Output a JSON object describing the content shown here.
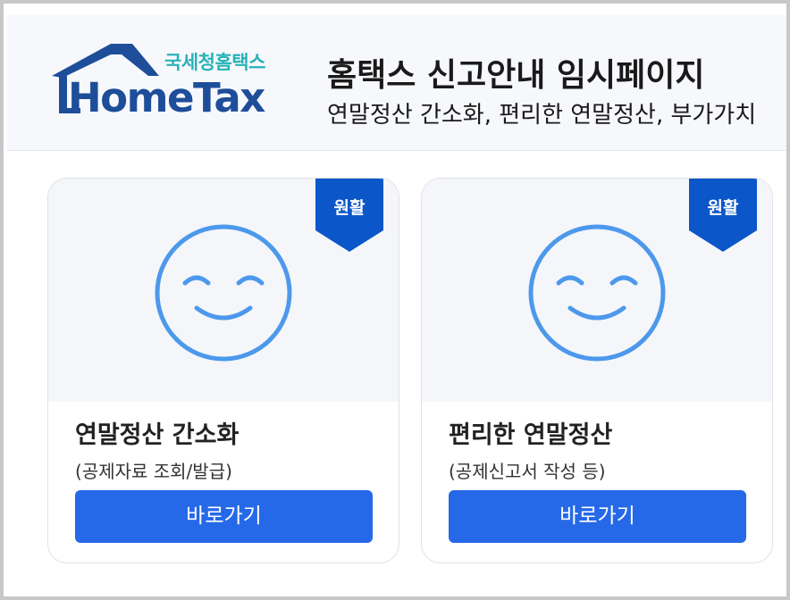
{
  "header": {
    "logo": {
      "korean": "국세청홈택스",
      "english": "HomeTax"
    },
    "title": "홈택스 신고안내 임시페이지",
    "subtitle": "연말정산 간소화, 편리한 연말정산, 부가가치"
  },
  "colors": {
    "accent_button": "#2669e8",
    "ribbon": "#0b57c9",
    "smiley": "#4c99ec",
    "logo_navy": "#1e4e9a",
    "logo_teal": "#27b3b8"
  },
  "cards": [
    {
      "icon": "smiley-icon",
      "status_badge": "원활",
      "title": "연말정산 간소화",
      "description": "(공제자료 조회/발급)",
      "button_label": "바로가기"
    },
    {
      "icon": "smiley-icon",
      "status_badge": "원활",
      "title": "편리한 연말정산",
      "description": "(공제신고서 작성 등)",
      "button_label": "바로가기"
    }
  ]
}
